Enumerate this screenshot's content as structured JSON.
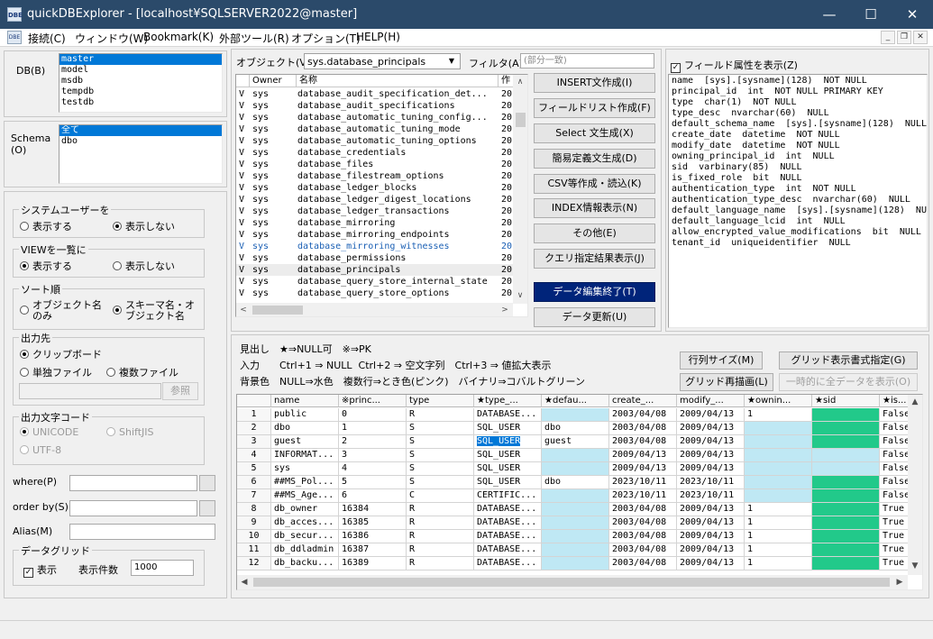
{
  "window": {
    "title": "quickDBExplorer - [localhost¥SQLSERVER2022@master]",
    "app_icon_text": "DBE"
  },
  "menu": {
    "items": [
      "接続(C)",
      "ウィンドウ(W)",
      "Bookmark(K)",
      "外部ツール(R)",
      "オプション(T)",
      "HELP(H)"
    ]
  },
  "db_panel": {
    "db_label": "DB(B)",
    "databases": [
      "master",
      "model",
      "msdb",
      "tempdb",
      "testdb"
    ],
    "selected_db": 0,
    "schema_label": "Schema (O)",
    "schema_label_line1": "Schema",
    "schema_label_line2": "(O)",
    "schemas": [
      "全て",
      "dbo"
    ],
    "selected_schema": 0
  },
  "options": {
    "system_user": {
      "label": "システムユーザーを",
      "show": "表示する",
      "hide": "表示しない",
      "selected": "hide"
    },
    "view_list": {
      "label": "VIEWを一覧に",
      "show": "表示する",
      "hide": "表示しない",
      "selected": "show"
    },
    "sort": {
      "label": "ソート順",
      "opt1_line1": "オブジェクト名",
      "opt1_line2": "のみ",
      "opt2_line1": "スキーマ名・オ",
      "opt2_line2": "ブジェクト名",
      "selected": "opt2"
    },
    "output": {
      "label": "出力先",
      "clipboard": "クリップボード",
      "single": "単独ファイル",
      "multi": "複数ファイル",
      "selected": "clipboard",
      "path_value": "",
      "browse": "参照"
    },
    "encoding": {
      "label": "出力文字コード",
      "unicode": "UNICODE",
      "shiftjis": "ShiftJIS",
      "utf8": "UTF-8",
      "selected": "unicode"
    },
    "where_label": "where(P)",
    "where_value": "",
    "orderby_label": "order by(S)",
    "orderby_value": "",
    "alias_label": "Alias(M)",
    "alias_value": "",
    "datagrid": {
      "label": "データグリッド",
      "show_label": "表示",
      "show_checked": true,
      "count_label": "表示件数",
      "count_value": "1000"
    }
  },
  "objects": {
    "label": "オブジェクト(V)",
    "combo_value": "sys.database_principals",
    "filter_label": "フィルタ(A)",
    "filter_placeholder": "(部分一致)",
    "columns": [
      "Owner",
      "名称",
      "作"
    ],
    "rows": [
      {
        "t": "V",
        "owner": "sys",
        "name": "database_audit_specification_det...",
        "v": "20"
      },
      {
        "t": "V",
        "owner": "sys",
        "name": "database_audit_specifications",
        "v": "20"
      },
      {
        "t": "V",
        "owner": "sys",
        "name": "database_automatic_tuning_config...",
        "v": "20"
      },
      {
        "t": "V",
        "owner": "sys",
        "name": "database_automatic_tuning_mode",
        "v": "20"
      },
      {
        "t": "V",
        "owner": "sys",
        "name": "database_automatic_tuning_options",
        "v": "20"
      },
      {
        "t": "V",
        "owner": "sys",
        "name": "database_credentials",
        "v": "20"
      },
      {
        "t": "V",
        "owner": "sys",
        "name": "database_files",
        "v": "20"
      },
      {
        "t": "V",
        "owner": "sys",
        "name": "database_filestream_options",
        "v": "20"
      },
      {
        "t": "V",
        "owner": "sys",
        "name": "database_ledger_blocks",
        "v": "20"
      },
      {
        "t": "V",
        "owner": "sys",
        "name": "database_ledger_digest_locations",
        "v": "20"
      },
      {
        "t": "V",
        "owner": "sys",
        "name": "database_ledger_transactions",
        "v": "20"
      },
      {
        "t": "V",
        "owner": "sys",
        "name": "database_mirroring",
        "v": "20"
      },
      {
        "t": "V",
        "owner": "sys",
        "name": "database_mirroring_endpoints",
        "v": "20"
      },
      {
        "t": "V",
        "owner": "sys",
        "name": "database_mirroring_witnesses",
        "v": "20"
      },
      {
        "t": "V",
        "owner": "sys",
        "name": "database_permissions",
        "v": "20"
      },
      {
        "t": "V",
        "owner": "sys",
        "name": "database_principals",
        "v": "20"
      },
      {
        "t": "V",
        "owner": "sys",
        "name": "database_query_store_internal_state",
        "v": "20"
      },
      {
        "t": "V",
        "owner": "sys",
        "name": "database_query_store_options",
        "v": "20"
      }
    ],
    "blue_row": 13,
    "highlight_row": 15
  },
  "actions": {
    "buttons": [
      "INSERT文作成(I)",
      "フィールドリスト作成(F)",
      "Select 文生成(X)",
      "簡易定義文生成(D)",
      "CSV等作成・読込(K)",
      "INDEX情報表示(N)",
      "その他(E)",
      "クエリ指定結果表示(J)",
      "データ編集終了(T)",
      "データ更新(U)"
    ]
  },
  "fields": {
    "checkbox_label": "フィールド属性を表示(Z)",
    "checked": true,
    "lines": [
      "name  [sys].[sysname](128)  NOT NULL",
      "principal_id  int  NOT NULL PRIMARY KEY",
      "type  char(1)  NOT NULL",
      "type_desc  nvarchar(60)  NULL",
      "default_schema_name  [sys].[sysname](128)  NULL",
      "create_date  datetime  NOT NULL",
      "modify_date  datetime  NOT NULL",
      "owning_principal_id  int  NULL",
      "sid  varbinary(85)  NULL",
      "is_fixed_role  bit  NULL",
      "authentication_type  int  NOT NULL",
      "authentication_type_desc  nvarchar(60)  NULL",
      "default_language_name  [sys].[sysname](128)  NU",
      "default_language_lcid  int  NULL",
      "allow_encrypted_value_modifications  bit  NULL",
      "tenant_id  uniqueidentifier  NULL"
    ]
  },
  "legend": {
    "line1": "見出し　★⇒NULL可　※⇒PK",
    "line2": "入力　　Ctrl+1 ⇒ NULL  Ctrl+2 ⇒ 空文字列　Ctrl+3 ⇒ 値拡大表示",
    "line3": "背景色　NULL⇒水色　複数行⇒とき色(ピンク)　バイナリ⇒コバルトグリーン"
  },
  "grid_buttons": {
    "col_size": "行列サイズ(M)",
    "grid_format": "グリッド表示書式指定(G)",
    "redraw": "グリッド再描画(L)",
    "show_all": "一時的に全データを表示(O)"
  },
  "grid": {
    "columns": [
      "name",
      "※princ...",
      "type",
      "★type_...",
      "★defau...",
      "create_...",
      "modify_...",
      "★ownin...",
      "★sid",
      "★is..."
    ],
    "rows": [
      [
        "1",
        "public",
        "0",
        "R",
        "DATABASE...",
        "",
        "2003/04/08",
        "2009/04/13",
        "1",
        "",
        "False"
      ],
      [
        "2",
        "dbo",
        "1",
        "S",
        "SQL_USER",
        "dbo",
        "2003/04/08",
        "2009/04/13",
        "",
        "",
        "False"
      ],
      [
        "3",
        "guest",
        "2",
        "S",
        "SQL_USER",
        "guest",
        "2003/04/08",
        "2009/04/13",
        "",
        "",
        "False"
      ],
      [
        "4",
        "INFORMAT...",
        "3",
        "S",
        "SQL_USER",
        "",
        "2009/04/13",
        "2009/04/13",
        "",
        "",
        "False"
      ],
      [
        "5",
        "sys",
        "4",
        "S",
        "SQL_USER",
        "",
        "2009/04/13",
        "2009/04/13",
        "",
        "",
        "False"
      ],
      [
        "6",
        "##MS_Pol...",
        "5",
        "S",
        "SQL_USER",
        "dbo",
        "2023/10/11",
        "2023/10/11",
        "",
        "",
        "False"
      ],
      [
        "7",
        "##MS_Age...",
        "6",
        "C",
        "CERTIFIC...",
        "",
        "2023/10/11",
        "2023/10/11",
        "",
        "",
        "False"
      ],
      [
        "8",
        "db_owner",
        "16384",
        "R",
        "DATABASE...",
        "",
        "2003/04/08",
        "2009/04/13",
        "1",
        "",
        "True"
      ],
      [
        "9",
        "db_acces...",
        "16385",
        "R",
        "DATABASE...",
        "",
        "2003/04/08",
        "2009/04/13",
        "1",
        "",
        "True"
      ],
      [
        "10",
        "db_secur...",
        "16386",
        "R",
        "DATABASE...",
        "",
        "2003/04/08",
        "2009/04/13",
        "1",
        "",
        "True"
      ],
      [
        "11",
        "db_ddladmin",
        "16387",
        "R",
        "DATABASE...",
        "",
        "2003/04/08",
        "2009/04/13",
        "1",
        "",
        "True"
      ],
      [
        "12",
        "db_backu...",
        "16389",
        "R",
        "DATABASE...",
        "",
        "2003/04/08",
        "2009/04/13",
        "1",
        "",
        "True"
      ]
    ],
    "selected_cell": [
      2,
      4
    ],
    "colors": {
      "null_aqua": "#bfe8f4",
      "binary_green": "#22c98a"
    }
  }
}
